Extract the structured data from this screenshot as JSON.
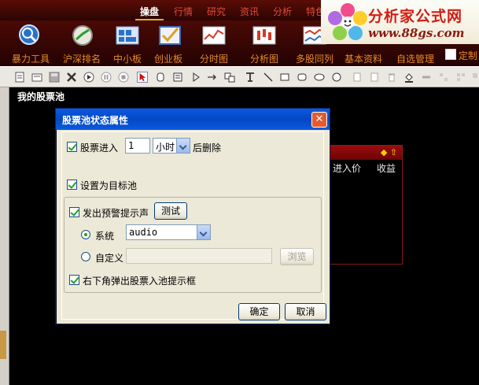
{
  "menu": {
    "items": [
      "操盘",
      "行情",
      "研究",
      "资讯",
      "分析",
      "特色"
    ],
    "active": "操盘"
  },
  "logo": {
    "title": "分析家公式网",
    "url": "www.88gs.com"
  },
  "toolbar": {
    "items": [
      "暴力工具",
      "沪深排名",
      "中小板",
      "创业板",
      "分时图",
      "分析图",
      "多股同列",
      "基本资料",
      "自选管理"
    ],
    "custom_label": "定制"
  },
  "pool": {
    "title": "我的股票池",
    "columns": [
      "进入价",
      "收益"
    ]
  },
  "dialog": {
    "title": "股票池状态属性",
    "close_glyph": "✕",
    "enter_prefix": "股票进入",
    "enter_value": "1",
    "unit_value": "小时",
    "enter_suffix": "后删除",
    "target_pool_label": "设置为目标池",
    "alarm_label": "发出预警提示声",
    "test_button": "测试",
    "system_label": "系统",
    "system_value": "audio",
    "custom_label": "自定义",
    "custom_value": "",
    "browse_button": "浏览",
    "popup_label": "右下角弹出股票入池提示框",
    "ok_button": "确定",
    "cancel_button": "取消"
  },
  "colors": {
    "title_bar": "#0a5bdc",
    "toolbar_bg": "#3a0704",
    "accent": "#e58a2a"
  }
}
